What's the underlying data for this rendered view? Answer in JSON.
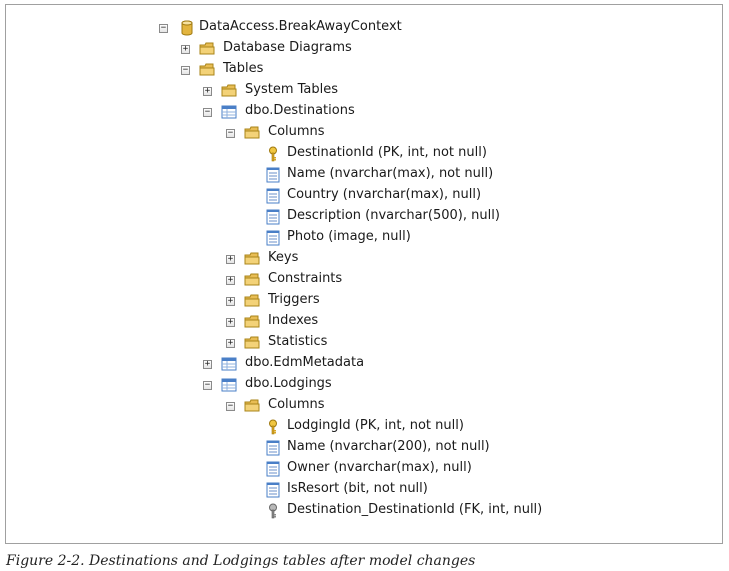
{
  "tree": {
    "root": "DataAccess.BreakAwayContext",
    "database_diagrams": "Database Diagrams",
    "tables": "Tables",
    "system_tables": "System Tables",
    "destinations": {
      "name": "dbo.Destinations",
      "columns_folder": "Columns",
      "columns": [
        "DestinationId (PK, int, not null)",
        "Name (nvarchar(max), not null)",
        "Country (nvarchar(max), null)",
        "Description (nvarchar(500), null)",
        "Photo (image, null)"
      ],
      "folders": [
        "Keys",
        "Constraints",
        "Triggers",
        "Indexes",
        "Statistics"
      ]
    },
    "edm_metadata": "dbo.EdmMetadata",
    "lodgings": {
      "name": "dbo.Lodgings",
      "columns_folder": "Columns",
      "columns": [
        "LodgingId (PK, int, not null)",
        "Name (nvarchar(200), not null)",
        "Owner (nvarchar(max), null)",
        "IsResort (bit, not null)",
        "Destination_DestinationId (FK, int, null)"
      ]
    },
    "expander_collapsed": "+",
    "expander_expanded": "−"
  },
  "icons": {
    "database": "database-icon",
    "folder": "folder-icon",
    "table": "table-icon",
    "primary_key": "primary-key-icon",
    "column": "column-icon",
    "foreign_key": "foreign-key-icon"
  },
  "colors": {
    "folder": "#e8bd54",
    "database": "#e3b53f",
    "table_header": "#4a7fc7",
    "key_gold": "#d9a521",
    "key_gray": "#8a8a8a"
  },
  "caption": "Figure 2-2. Destinations and Lodgings tables after model changes"
}
